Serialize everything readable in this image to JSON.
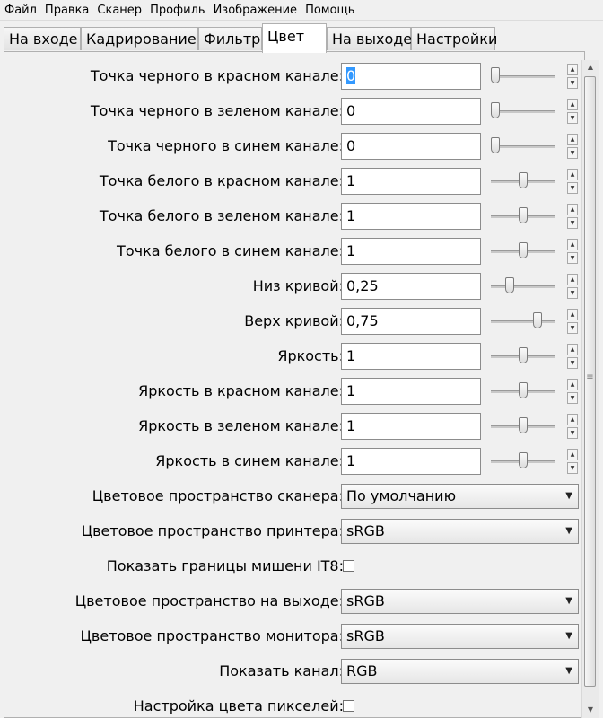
{
  "menu": [
    "Файл",
    "Правка",
    "Сканер",
    "Профиль",
    "Изображение",
    "Помощь"
  ],
  "tabs": [
    "На входе",
    "Кадрирование",
    "Фильтр",
    "Цвет",
    "На выходе",
    "Настройки"
  ],
  "active_tab": "Цвет",
  "fields": [
    {
      "label": "Точка черного в красном канале:",
      "value": "0",
      "slider": 0.0
    },
    {
      "label": "Точка черного в зеленом канале:",
      "value": "0",
      "slider": 0.0
    },
    {
      "label": "Точка черного в синем канале:",
      "value": "0",
      "slider": 0.0
    },
    {
      "label": "Точка белого в красном канале:",
      "value": "1",
      "slider": 0.5
    },
    {
      "label": "Точка белого в зеленом канале:",
      "value": "1",
      "slider": 0.5
    },
    {
      "label": "Точка белого в синем канале:",
      "value": "1",
      "slider": 0.5
    },
    {
      "label": "Низ кривой:",
      "value": "0,25",
      "slider": 0.25
    },
    {
      "label": "Верх кривой:",
      "value": "0,75",
      "slider": 0.75
    },
    {
      "label": "Яркость:",
      "value": "1",
      "slider": 0.5
    },
    {
      "label": "Яркость в красном канале:",
      "value": "1",
      "slider": 0.5
    },
    {
      "label": "Яркость в зеленом канале:",
      "value": "1",
      "slider": 0.5
    },
    {
      "label": "Яркость в синем канале:",
      "value": "1",
      "slider": 0.5
    }
  ],
  "combos": {
    "scanner_space": {
      "label": "Цветовое пространство сканера:",
      "value": "По умолчанию"
    },
    "printer_space": {
      "label": "Цветовое пространство принтера:",
      "value": "sRGB"
    },
    "output_space": {
      "label": "Цветовое пространство на выходе:",
      "value": "sRGB"
    },
    "monitor_space": {
      "label": "Цветовое пространство монитора:",
      "value": "sRGB"
    },
    "show_channel": {
      "label": "Показать канал:",
      "value": "RGB"
    }
  },
  "checks": {
    "it8": {
      "label": "Показать границы мишени IT8:",
      "checked": false
    },
    "pixel_color": {
      "label": "Настройка цвета пикселей:",
      "checked": false
    }
  },
  "icons": {
    "spin_up": "spin-up-icon",
    "spin_down": "spin-down-icon",
    "combo_arrow": "chevron-down-icon"
  }
}
